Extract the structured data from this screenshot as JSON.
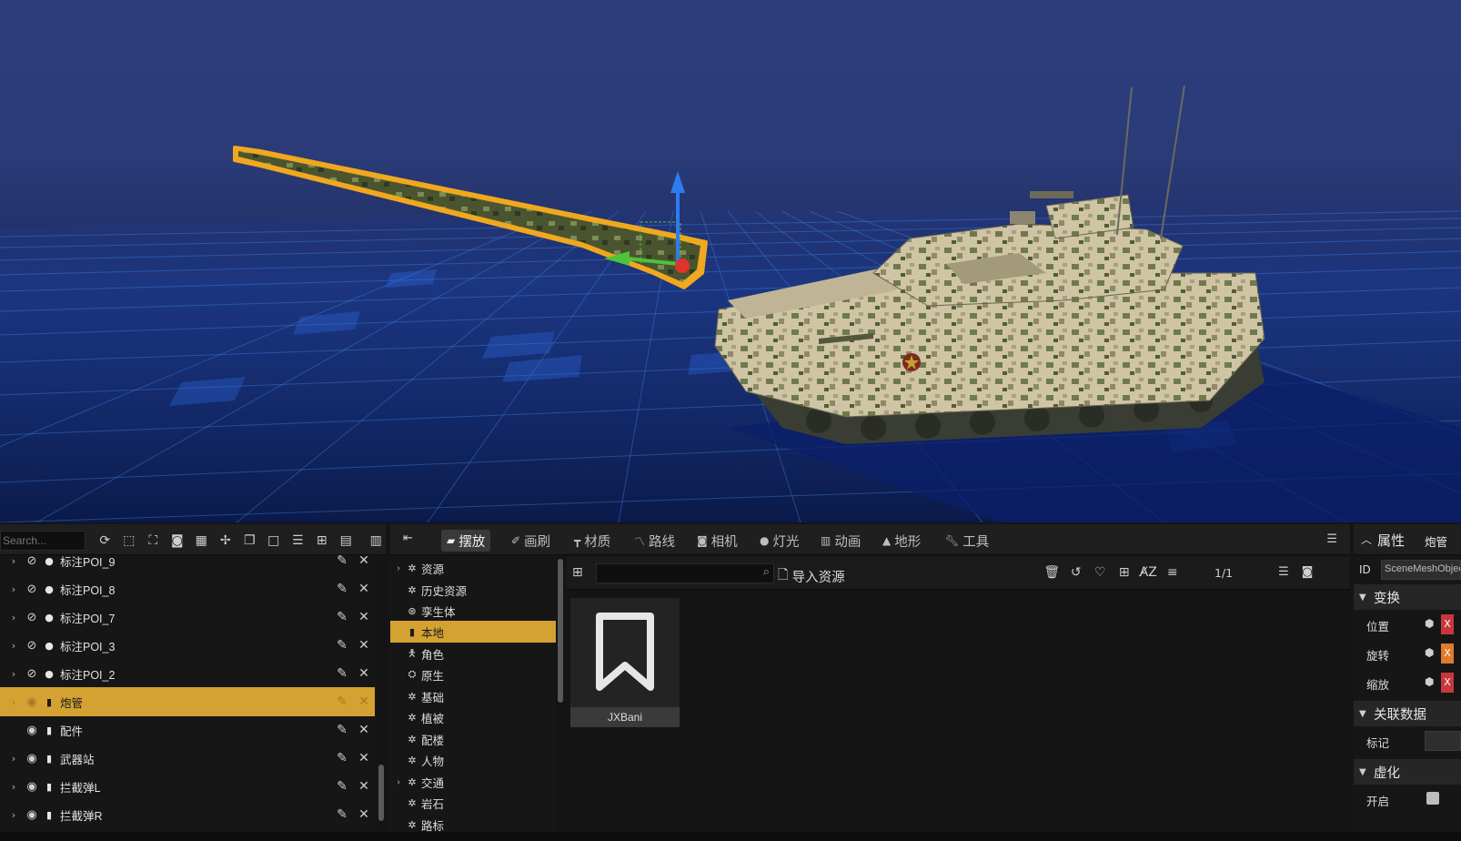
{
  "outliner": {
    "search_placeholder": "Search...",
    "toolbar_icons": [
      "refresh-icon",
      "select-icon",
      "focus-icon",
      "camera-icon",
      "clapper-icon",
      "collapse-icon",
      "copy-icon",
      "square-icon",
      "list-icon",
      "add-icon",
      "form-icon"
    ],
    "rows": [
      {
        "label": "标注POI_9",
        "type": "poi",
        "expandable": true,
        "visible": false,
        "selected": false
      },
      {
        "label": "标注POI_8",
        "type": "poi",
        "expandable": true,
        "visible": false,
        "selected": false
      },
      {
        "label": "标注POI_7",
        "type": "poi",
        "expandable": true,
        "visible": false,
        "selected": false
      },
      {
        "label": "标注POI_3",
        "type": "poi",
        "expandable": true,
        "visible": false,
        "selected": false
      },
      {
        "label": "标注POI_2",
        "type": "poi",
        "expandable": true,
        "visible": false,
        "selected": false
      },
      {
        "label": "炮管",
        "type": "mesh",
        "expandable": true,
        "visible": true,
        "selected": true
      },
      {
        "label": "配件",
        "type": "mesh",
        "expandable": false,
        "visible": true,
        "selected": false
      },
      {
        "label": "武器站",
        "type": "mesh",
        "expandable": true,
        "visible": true,
        "selected": false
      },
      {
        "label": "拦截弹L",
        "type": "mesh",
        "expandable": true,
        "visible": true,
        "selected": false
      },
      {
        "label": "拦截弹R",
        "type": "mesh",
        "expandable": true,
        "visible": true,
        "selected": false
      }
    ]
  },
  "content": {
    "tabs": [
      {
        "label": "摆放",
        "icon": "place-icon",
        "active": true
      },
      {
        "label": "画刷",
        "icon": "brush-icon",
        "active": false
      },
      {
        "label": "材质",
        "icon": "paint-roller-icon",
        "active": false
      },
      {
        "label": "路线",
        "icon": "route-icon",
        "active": false
      },
      {
        "label": "相机",
        "icon": "camera-icon",
        "active": false
      },
      {
        "label": "灯光",
        "icon": "bulb-icon",
        "active": false
      },
      {
        "label": "动画",
        "icon": "film-icon",
        "active": false
      },
      {
        "label": "地形",
        "icon": "mountain-icon",
        "active": false
      },
      {
        "label": "工具",
        "icon": "wrench-icon",
        "active": false
      }
    ],
    "tree": [
      {
        "label": "资源",
        "expandable": true,
        "selected": false
      },
      {
        "label": "历史资源",
        "expandable": false,
        "selected": false
      },
      {
        "label": "孪生体",
        "expandable": false,
        "selected": false
      },
      {
        "label": "本地",
        "expandable": false,
        "selected": true
      },
      {
        "label": "角色",
        "expandable": false,
        "selected": false
      },
      {
        "label": "原生",
        "expandable": false,
        "selected": false
      },
      {
        "label": "基础",
        "expandable": false,
        "selected": false
      },
      {
        "label": "植被",
        "expandable": false,
        "selected": false
      },
      {
        "label": "配楼",
        "expandable": false,
        "selected": false
      },
      {
        "label": "人物",
        "expandable": false,
        "selected": false
      },
      {
        "label": "交通",
        "expandable": true,
        "selected": false
      },
      {
        "label": "岩石",
        "expandable": false,
        "selected": false
      },
      {
        "label": "路标",
        "expandable": false,
        "selected": false
      }
    ],
    "import_label": "导入资源",
    "page_indicator": "1/1",
    "assets": [
      {
        "name": "JXBani",
        "icon": "bookmark-icon"
      }
    ]
  },
  "details": {
    "title": "属性",
    "object_name": "炮管",
    "id_label": "ID",
    "id_value": "SceneMeshObject",
    "sections": {
      "transform": "变换",
      "linked_data": "关联数据",
      "virtualize": "虚化"
    },
    "rows": {
      "position": "位置",
      "rotation": "旋转",
      "scale": "缩放",
      "tag": "标记",
      "enable": "开启"
    },
    "axis_badge": "X"
  },
  "colors": {
    "accent": "#d4a233",
    "viewport_sky": "#2c3e7c",
    "grid_line": "#3a7bd5",
    "selection_outline": "#f0a81e"
  }
}
